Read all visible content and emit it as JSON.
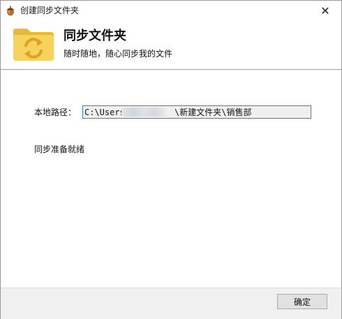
{
  "window": {
    "title": "创建同步文件夹",
    "close_glyph": "✕"
  },
  "header": {
    "title": "同步文件夹",
    "subtitle": "随时随地，随心同步我的文件"
  },
  "form": {
    "path_label": "本地路径：",
    "path_value_prefix": "C:\\Users\\",
    "path_value_suffix": "\\新建文件夹\\销售部",
    "status": "同步准备就绪"
  },
  "footer": {
    "ok_label": "确定"
  },
  "icons": {
    "app": "acorn-icon",
    "header": "sync-folder-icon"
  },
  "colors": {
    "folder": "#f2c84b",
    "sync_arrows": "#e0a020",
    "field_border": "#3c7fb1"
  }
}
